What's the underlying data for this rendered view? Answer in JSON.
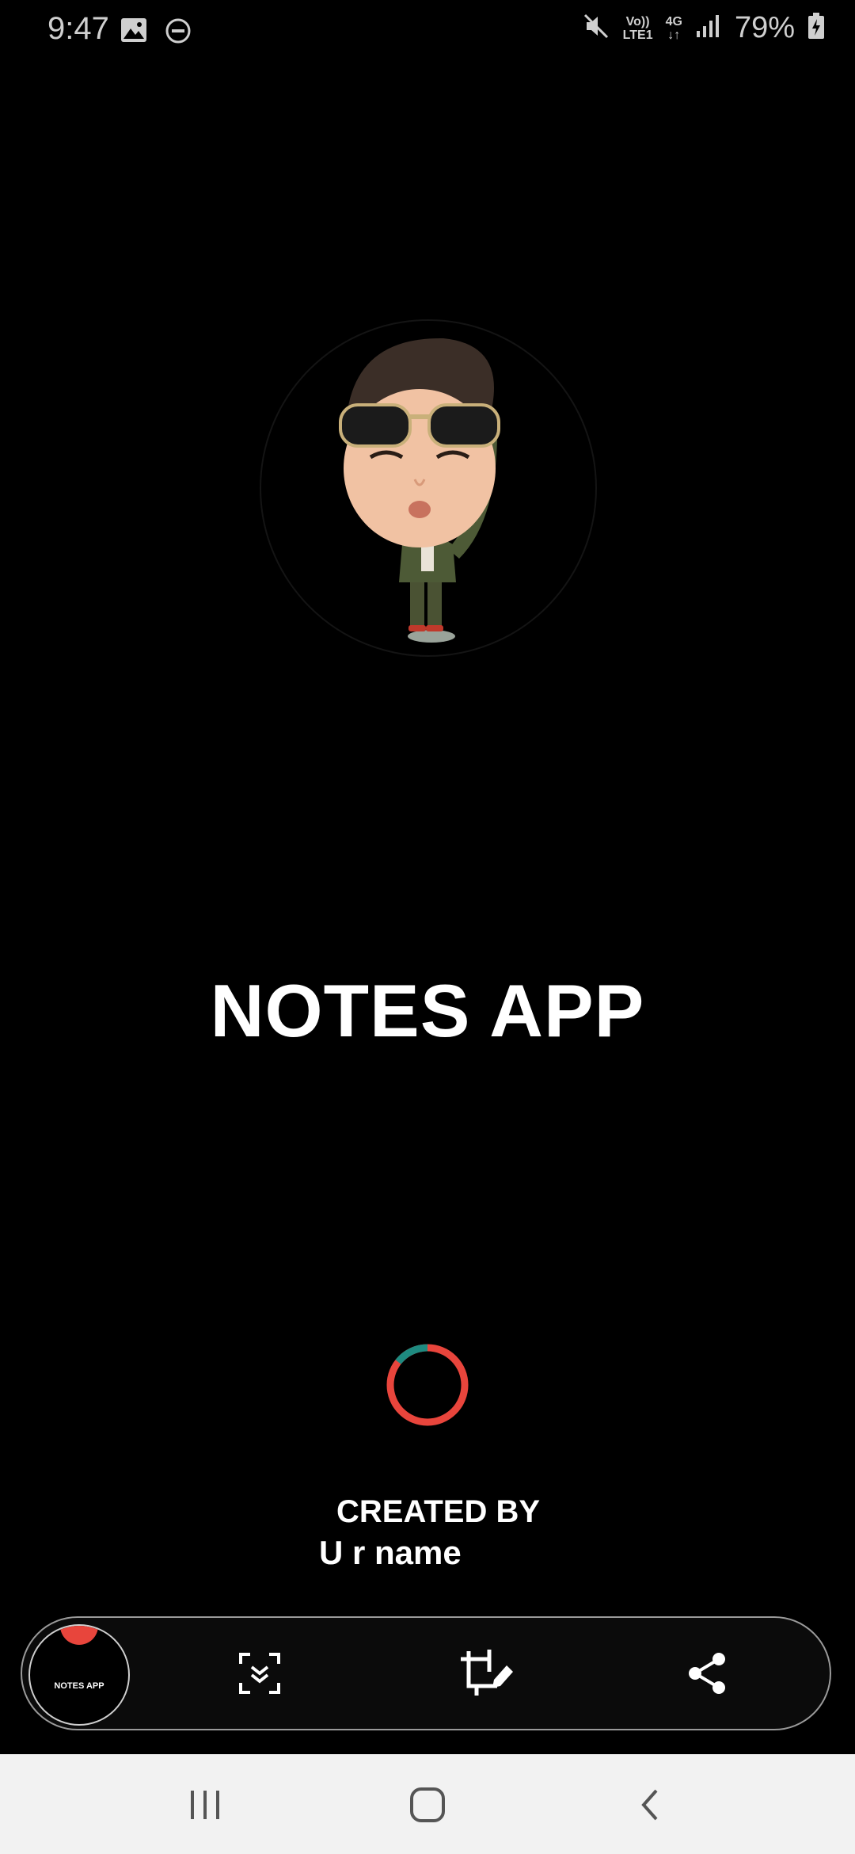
{
  "status_bar": {
    "time": "9:47",
    "left_icons": [
      "gallery-icon",
      "do-not-disturb-icon"
    ],
    "right_icons": [
      "mute-icon",
      "volte-icon",
      "4g-icon",
      "signal-icon",
      "battery-icon"
    ],
    "volte_label_top": "Vo))",
    "volte_label_bottom": "LTE1",
    "network_label": "4G",
    "battery_percent": "79%"
  },
  "splash": {
    "avatar": "avatar-sticker",
    "title": "NOTES APP",
    "loading_indicator": "spinner",
    "created_by_label": "CREATED BY",
    "creator_name": "U r name"
  },
  "screenshot_toolbar": {
    "thumbnail_label": "NOTES APP",
    "buttons": [
      "scroll-capture-icon",
      "crop-edit-icon",
      "share-icon"
    ]
  },
  "navigation_bar": {
    "buttons": [
      "recent-apps-icon",
      "home-icon",
      "back-icon"
    ]
  },
  "colors": {
    "background": "#000000",
    "text": "#ffffff",
    "spinner_primary": "#e8453c",
    "spinner_accent": "#1e8a80",
    "nav_bar_bg": "#f2f2f2"
  }
}
